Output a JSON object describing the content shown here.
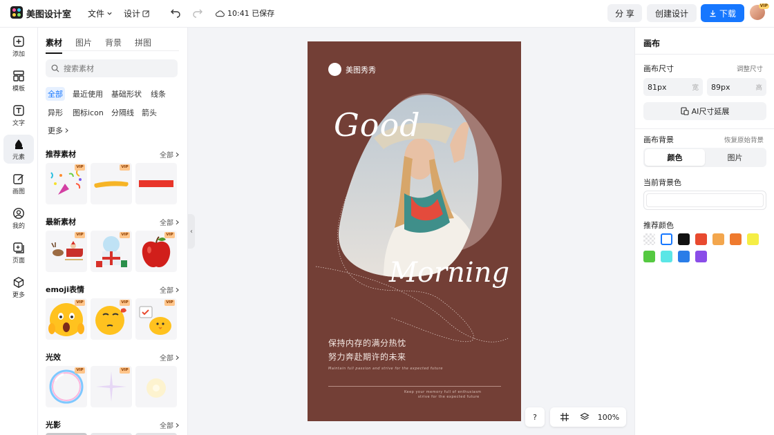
{
  "app": {
    "name": "美图设计室"
  },
  "header": {
    "file_label": "文件",
    "design_label": "设计",
    "save_status": "10:41 已保存",
    "share_label": "分 享",
    "create_label": "创建设计",
    "download_label": "下载",
    "vip_badge": "VIP"
  },
  "rail": {
    "items": [
      {
        "label": "添加",
        "icon": "plus-square-icon"
      },
      {
        "label": "模板",
        "icon": "template-icon"
      },
      {
        "label": "文字",
        "icon": "text-icon"
      },
      {
        "label": "元素",
        "icon": "shapes-icon",
        "active": true
      },
      {
        "label": "画图",
        "icon": "edit-icon"
      },
      {
        "label": "我的",
        "icon": "user-icon"
      },
      {
        "label": "页面",
        "icon": "page-icon"
      },
      {
        "label": "更多",
        "icon": "cube-icon"
      }
    ]
  },
  "assets": {
    "tabs": [
      "素材",
      "图片",
      "背景",
      "拼图"
    ],
    "search_placeholder": "搜索素材",
    "chips": [
      "全部",
      "最近使用",
      "基础形状",
      "线条",
      "异形",
      "图标icon",
      "分隔线",
      "箭头",
      "更多"
    ],
    "all_label": "全部",
    "vip_label": "VIP",
    "sections": [
      {
        "title": "推荐素材"
      },
      {
        "title": "最新素材"
      },
      {
        "title": "emoji表情"
      },
      {
        "title": "光效"
      },
      {
        "title": "光影"
      }
    ]
  },
  "poster": {
    "brand": "美图秀秀",
    "word1": "Good",
    "word2": "Morning",
    "cn_line1": "保持内存的满分热忱",
    "cn_line2": "努力奔赴期许的未来",
    "en_small": "Maintain full passion and strive for the expected future",
    "en_footer1": "Keep your memory full of enthusiasm",
    "en_footer2": "strive for the expected future",
    "bg_color": "#733f36"
  },
  "zoom": {
    "help": "?",
    "level": "100%"
  },
  "properties": {
    "title": "画布",
    "size_label": "画布尺寸",
    "adjust_label": "调整尺寸",
    "width_value": "81px",
    "width_unit": "宽",
    "height_value": "89px",
    "height_unit": "高",
    "ai_extend_label": "AI尺寸延展",
    "bg_label": "画布背景",
    "restore_label": "恢复原始背景",
    "seg_color": "颜色",
    "seg_image": "图片",
    "current_bg_label": "当前背景色",
    "recommend_label": "推荐颜色",
    "swatches": [
      "transparent",
      "#ffffff",
      "#111111",
      "#e84a2f",
      "#f3a64d",
      "#ef7a2e",
      "#f5ee45",
      "#55c941",
      "#5be6e6",
      "#2a7de8",
      "#8a4de8"
    ]
  }
}
